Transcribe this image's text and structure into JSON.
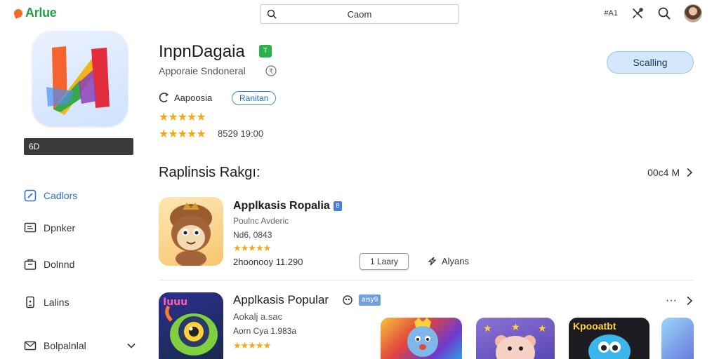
{
  "topbar": {
    "logo_text": "Arlue",
    "search_text": "Caom",
    "right_label": "#A1"
  },
  "app": {
    "title": "InpnDagaia",
    "badge": "T",
    "subtitle": "Apporaie Sndoneral",
    "developer": "Aapoosia",
    "developer_pill": "Ranitan",
    "stars_1": "★★★★★",
    "stars_2": "★★★★★",
    "stats": "8529  19:00",
    "install_label": "Scalling",
    "dark_bar_label": "6D"
  },
  "sidebar": {
    "items": [
      {
        "label": "Cadlors"
      },
      {
        "label": "Dpnker"
      },
      {
        "label": "Dolnnd"
      },
      {
        "label": "Lalins"
      },
      {
        "label": "Bolpalnlal"
      }
    ]
  },
  "section": {
    "title": "Raplinsis Rakgı:",
    "more_label": "00c4 M"
  },
  "card1": {
    "name": "Applkasis Ropalia",
    "badge": "B",
    "subtitle": "Poulnc Avderic",
    "meta": "Nd6, 0843",
    "stars": "★★★★★",
    "stats": "2hoonooy 11.290",
    "button_label": "1 Laary",
    "link_label": "Alyans"
  },
  "card2": {
    "name": "Applkasis Popular",
    "badge": "aisy9",
    "subtitle": "Aokalj a.sac",
    "meta": "Aorn Cya 1.983a",
    "stars": "★★★★★",
    "more": "···"
  },
  "thumbs": {
    "t3_title": "Kpooatbt"
  },
  "colors": {
    "accent_green": "#22a145",
    "accent_blue": "#2d6fd6",
    "install_bg": "#d4e7fb",
    "star": "#f2a91a"
  }
}
